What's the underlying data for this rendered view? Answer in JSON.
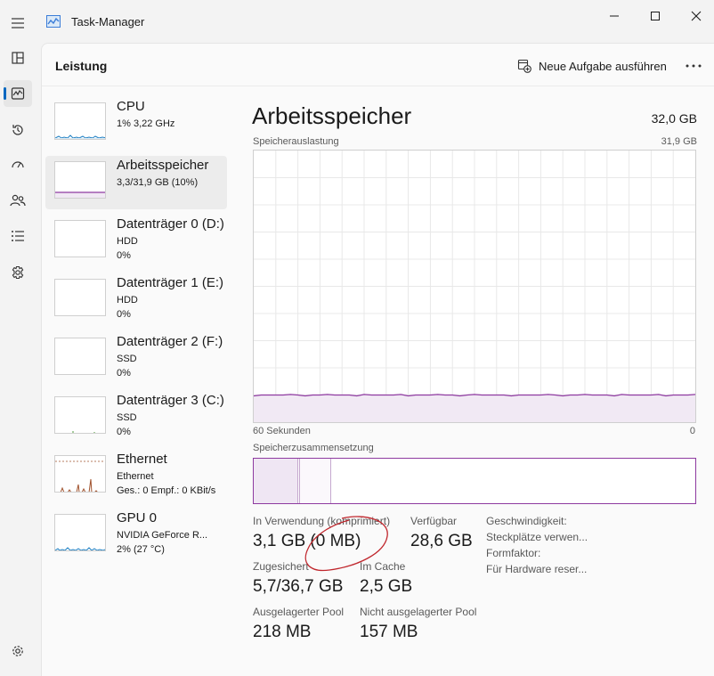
{
  "window": {
    "title": "Task-Manager",
    "controls": [
      "minimize-icon",
      "maximize-icon",
      "close-icon"
    ]
  },
  "nav_rail": {
    "items": [
      {
        "icon": "hamburger-menu-icon"
      },
      {
        "icon": "processes-icon"
      },
      {
        "icon": "performance-icon",
        "active": true
      },
      {
        "icon": "app-history-icon"
      },
      {
        "icon": "startup-apps-icon"
      },
      {
        "icon": "users-icon"
      },
      {
        "icon": "details-icon"
      },
      {
        "icon": "services-icon"
      }
    ],
    "settings_icon": "gear-icon"
  },
  "header": {
    "page_title": "Leistung",
    "run_task_label": "Neue Aufgabe ausführen",
    "more_icon": "more-horizontal-icon"
  },
  "sidebar": {
    "items": [
      {
        "name": "CPU",
        "line1": "1% 3,22 GHz",
        "line2": ""
      },
      {
        "name": "Arbeitsspeicher",
        "line1": "3,3/31,9 GB (10%)",
        "line2": "",
        "selected": true
      },
      {
        "name": "Datenträger 0 (D:)",
        "line1": "HDD",
        "line2": "0%"
      },
      {
        "name": "Datenträger 1 (E:)",
        "line1": "HDD",
        "line2": "0%"
      },
      {
        "name": "Datenträger 2 (F:)",
        "line1": "SSD",
        "line2": "0%"
      },
      {
        "name": "Datenträger 3 (C:)",
        "line1": "SSD",
        "line2": "0%"
      },
      {
        "name": "Ethernet",
        "line1": "Ethernet",
        "line2": "Ges.: 0 Empf.: 0 KBit/s"
      },
      {
        "name": "GPU 0",
        "line1": "NVIDIA GeForce R...",
        "line2": "2% (27 °C)"
      }
    ]
  },
  "main": {
    "title": "Arbeitsspeicher",
    "total": "32,0 GB",
    "usage_label": "Speicherauslastung",
    "usage_max": "31,9 GB",
    "time_label": "60 Sekunden",
    "time_end": "0",
    "usage_fraction": 0.1,
    "composition_label": "Speicherzusammensetzung",
    "stats": {
      "in_use_label": "In Verwendung (komprimiert)",
      "in_use_value": "3,1 GB (0 MB)",
      "available_label": "Verfügbar",
      "available_value": "28,6 GB",
      "committed_label": "Zugesichert",
      "committed_value": "5,7/36,7 GB",
      "cached_label": "Im Cache",
      "cached_value": "2,5 GB",
      "paged_label": "Ausgelagerter Pool",
      "paged_value": "218 MB",
      "nonpaged_label": "Nicht ausgelagerter Pool",
      "nonpaged_value": "157 MB"
    },
    "meta": {
      "speed": "Geschwindigkeit:",
      "slots": "Steckplätze verwen...",
      "form": "Formfaktor:",
      "reserved": "Für Hardware reser..."
    }
  },
  "colors": {
    "memory": "#8e3aa0",
    "memory_fill": "#f1e9f4",
    "cpu": "#1c7ec2",
    "ethernet": "#a0522d",
    "annotation": "#c0272d"
  }
}
